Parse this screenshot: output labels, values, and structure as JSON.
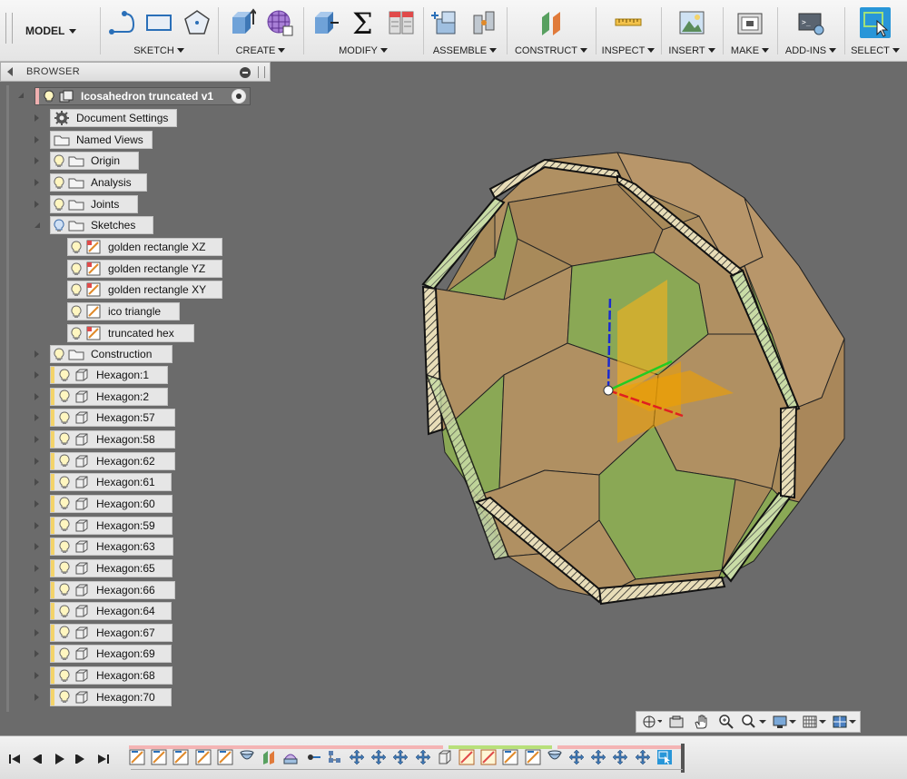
{
  "toolbar": {
    "mode_label": "MODEL",
    "groups": [
      {
        "label": "SKETCH"
      },
      {
        "label": "CREATE"
      },
      {
        "label": "MODIFY"
      },
      {
        "label": "ASSEMBLE"
      },
      {
        "label": "CONSTRUCT"
      },
      {
        "label": "INSPECT"
      },
      {
        "label": "INSERT"
      },
      {
        "label": "MAKE"
      },
      {
        "label": "ADD-INS"
      },
      {
        "label": "SELECT"
      }
    ]
  },
  "browser": {
    "title": "BROWSER",
    "root_label": "Icosahedron truncated v1",
    "items": [
      {
        "label": "Document Settings",
        "icon": "gear-icon"
      },
      {
        "label": "Named Views",
        "icon": "folder-icon"
      },
      {
        "label": "Origin",
        "icon": "folder-icon"
      },
      {
        "label": "Analysis",
        "icon": "folder-icon"
      },
      {
        "label": "Joints",
        "icon": "folder-icon"
      },
      {
        "label": "Sketches",
        "icon": "folder-icon"
      }
    ],
    "sketches": [
      {
        "label": "golden rectangle XZ"
      },
      {
        "label": "golden rectangle YZ"
      },
      {
        "label": "golden rectangle XY"
      },
      {
        "label": "ico triangle"
      },
      {
        "label": "truncated hex"
      }
    ],
    "construction_label": "Construction",
    "bodies": [
      {
        "label": "Hexagon:1"
      },
      {
        "label": "Hexagon:2"
      },
      {
        "label": "Hexagon:57"
      },
      {
        "label": "Hexagon:58"
      },
      {
        "label": "Hexagon:62"
      },
      {
        "label": "Hexagon:61"
      },
      {
        "label": "Hexagon:60"
      },
      {
        "label": "Hexagon:59"
      },
      {
        "label": "Hexagon:63"
      },
      {
        "label": "Hexagon:65"
      },
      {
        "label": "Hexagon:66"
      },
      {
        "label": "Hexagon:64"
      },
      {
        "label": "Hexagon:67"
      },
      {
        "label": "Hexagon:69"
      },
      {
        "label": "Hexagon:68"
      },
      {
        "label": "Hexagon:70"
      }
    ]
  },
  "colors": {
    "canvas": "#6b6b6b",
    "hexagon_face": "#b09060",
    "pentagon_face": "#8aa855",
    "select_blue": "#2896d8",
    "timeline_pink": "#f4b4b4",
    "timeline_green": "#b8e07a"
  }
}
